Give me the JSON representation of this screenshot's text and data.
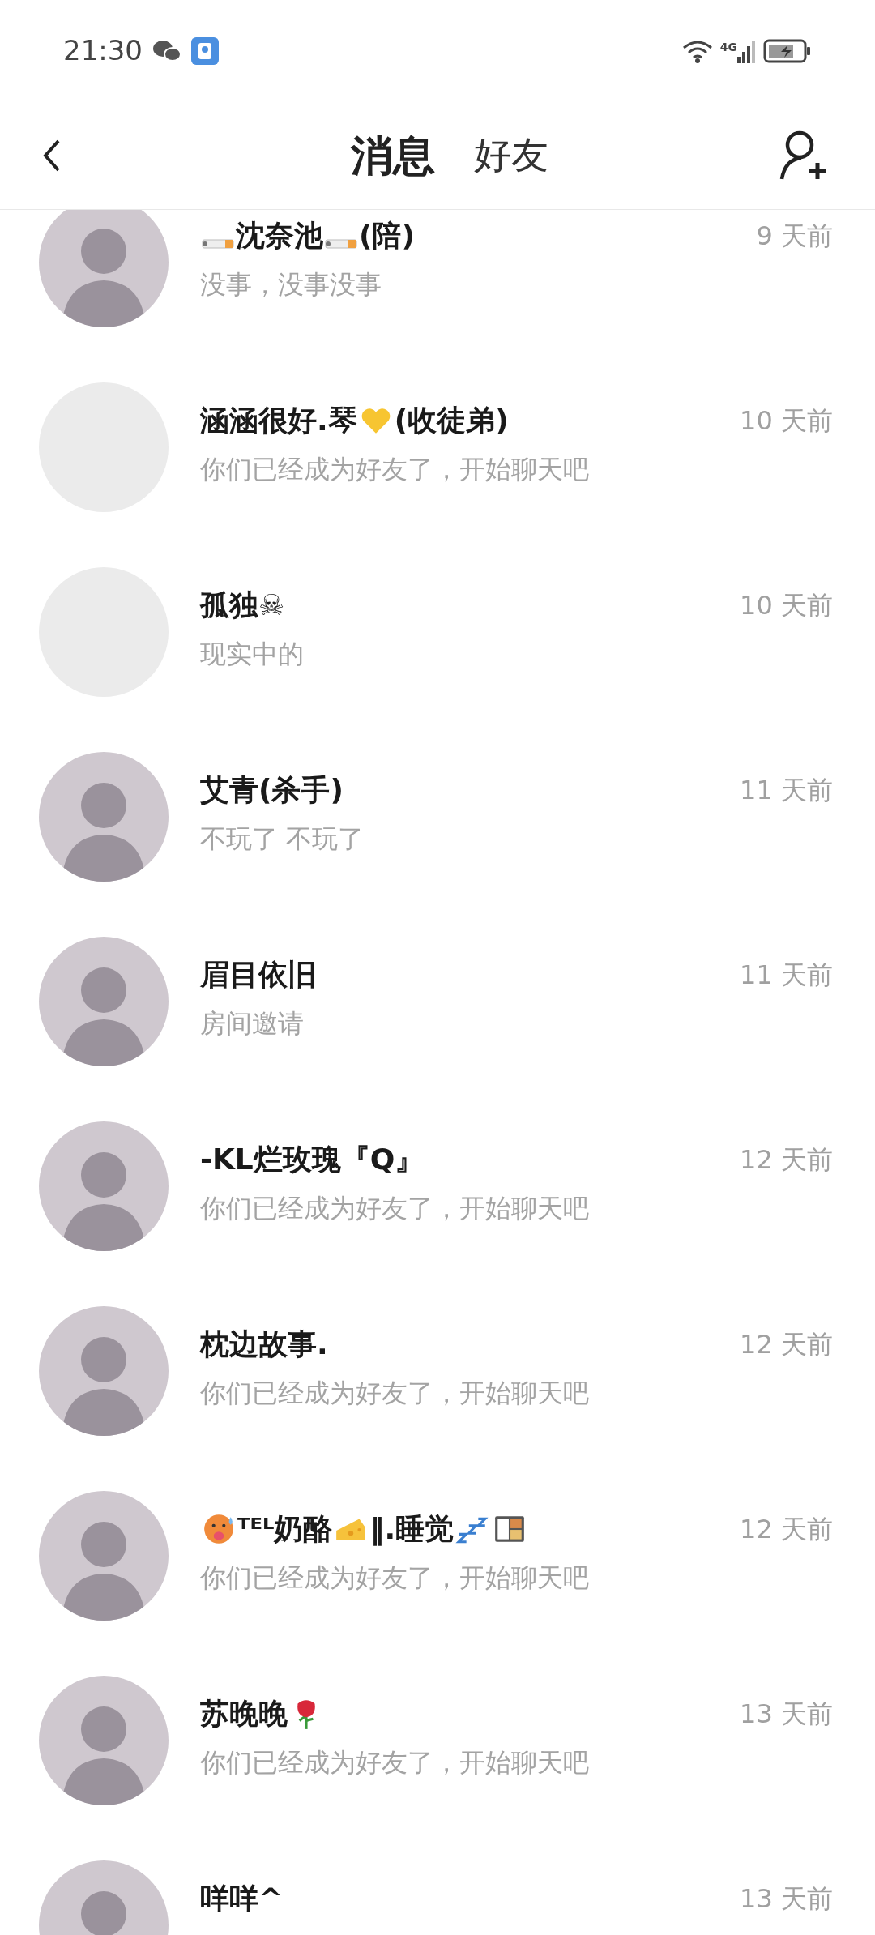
{
  "status_bar": {
    "time": "21:30",
    "network": "4G"
  },
  "tabs": [
    {
      "label": "消息",
      "selected": true
    },
    {
      "label": "好友",
      "selected": false
    }
  ],
  "conversations": [
    {
      "photo": true,
      "name": [
        {
          "kind": "cigarette"
        },
        {
          "kind": "text",
          "text": "沈奈池"
        },
        {
          "kind": "cigarette"
        },
        {
          "kind": "text",
          "text": "(陪)"
        }
      ],
      "time": "9 天前",
      "message": "没事，没事没事"
    },
    {
      "photo": false,
      "name": [
        {
          "kind": "text",
          "text": "涵涵很好.琴"
        },
        {
          "kind": "heart"
        },
        {
          "kind": "text",
          "text": "(收徒弟)"
        }
      ],
      "time": "10 天前",
      "message": "你们已经成为好友了，开始聊天吧"
    },
    {
      "photo": false,
      "name": [
        {
          "kind": "text",
          "text": "孤独☠"
        }
      ],
      "time": "10 天前",
      "message": "现实中的"
    },
    {
      "photo": true,
      "name": [
        {
          "kind": "text",
          "text": "艾青(杀手)"
        }
      ],
      "time": "11 天前",
      "message": "不玩了 不玩了"
    },
    {
      "photo": true,
      "name": [
        {
          "kind": "text",
          "text": "眉目依旧"
        }
      ],
      "time": "11 天前",
      "message": "房间邀请"
    },
    {
      "photo": true,
      "name": [
        {
          "kind": "text",
          "text": "-KL烂玫瑰『Q』"
        }
      ],
      "time": "12 天前",
      "message": "你们已经成为好友了，开始聊天吧"
    },
    {
      "photo": true,
      "name": [
        {
          "kind": "text",
          "text": "枕边故事."
        }
      ],
      "time": "12 天前",
      "message": "你们已经成为好友了，开始聊天吧"
    },
    {
      "photo": true,
      "name": [
        {
          "kind": "hotface"
        },
        {
          "kind": "text",
          "text": "ᵀᴱᴸ奶酪"
        },
        {
          "kind": "cheese"
        },
        {
          "kind": "text",
          "text": "‖.睡觉"
        },
        {
          "kind": "zzz"
        },
        {
          "kind": "bento"
        }
      ],
      "time": "12 天前",
      "message": "你们已经成为好友了，开始聊天吧"
    },
    {
      "photo": true,
      "name": [
        {
          "kind": "text",
          "text": "苏晚晚"
        },
        {
          "kind": "rose"
        }
      ],
      "time": "13 天前",
      "message": "你们已经成为好友了，开始聊天吧"
    },
    {
      "photo": true,
      "name": [
        {
          "kind": "text",
          "text": "咩咩^"
        }
      ],
      "time": "13 天前"
    }
  ]
}
